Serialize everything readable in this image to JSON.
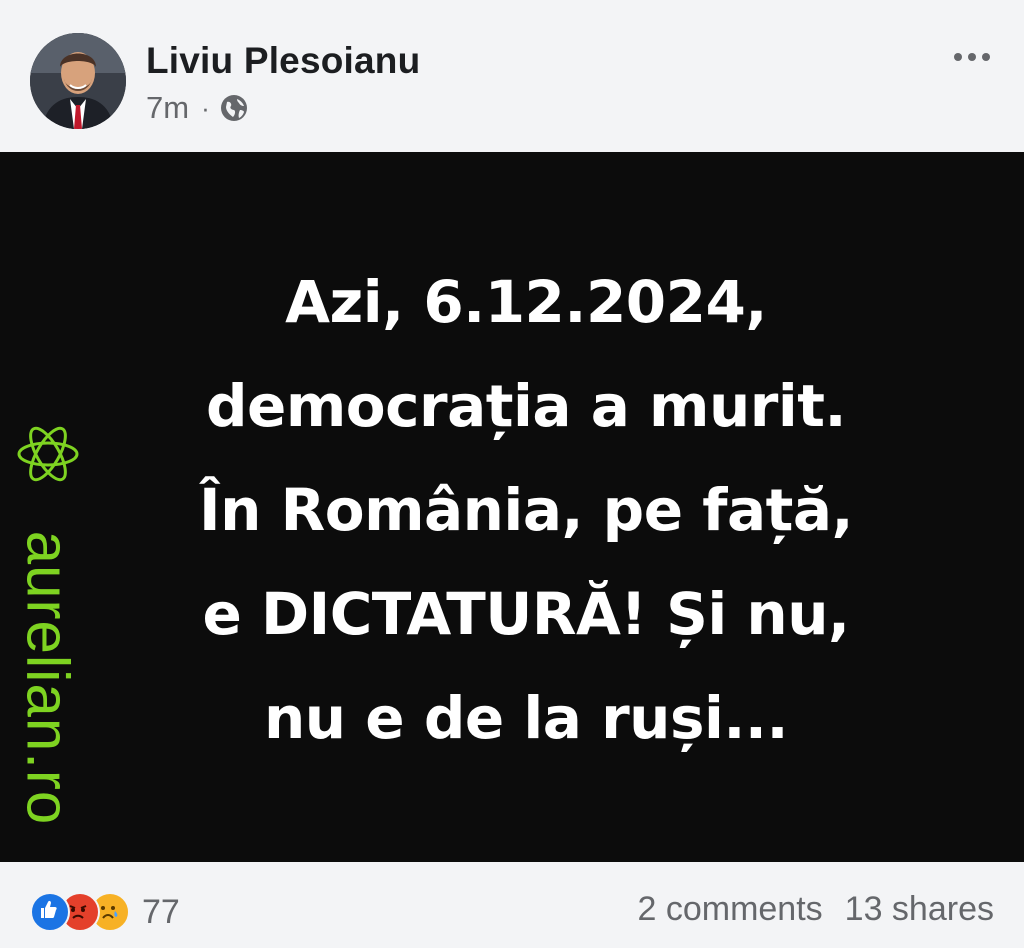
{
  "post": {
    "author": "Liviu Plesoianu",
    "time": "7m",
    "separator": "·",
    "audience_icon": "globe-icon"
  },
  "image": {
    "watermark": "aurelian.ro",
    "watermark_color": "#7ed321",
    "lines": [
      "Azi, 6.12.2024,",
      "democrația a murit.",
      "În România, pe față,",
      "e DICTATURĂ! Și nu,",
      "nu e de la ruși..."
    ]
  },
  "footer": {
    "reaction_icons": [
      "like-icon",
      "angry-icon",
      "sad-icon"
    ],
    "reaction_count": "77",
    "comments": "2 comments",
    "shares": "13 shares"
  },
  "colors": {
    "like": "#1b74e4",
    "angry": "#e4402b",
    "sad": "#f7b125"
  }
}
